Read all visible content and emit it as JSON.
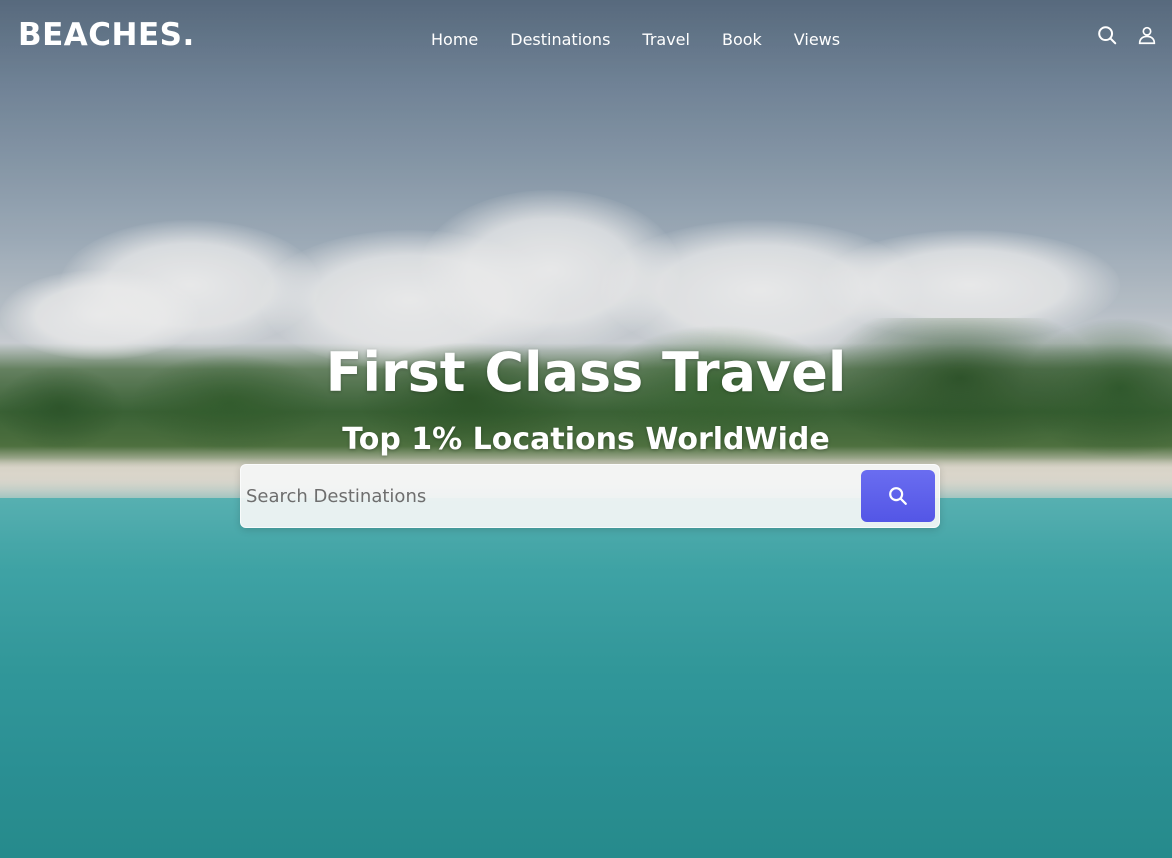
{
  "brand": {
    "logo": "BEACHES."
  },
  "nav": {
    "links": [
      {
        "label": "Home"
      },
      {
        "label": "Destinations"
      },
      {
        "label": "Travel"
      },
      {
        "label": "Book"
      },
      {
        "label": "Views"
      }
    ],
    "icons": [
      "search-icon",
      "user-icon"
    ]
  },
  "hero": {
    "title": "First Class Travel",
    "subtitle": "Top 1% Locations WorldWide"
  },
  "search": {
    "placeholder": "Search Destinations",
    "value": "",
    "button_icon": "search-icon"
  },
  "colors": {
    "accent": "#5a5cec",
    "text": "#ffffff"
  }
}
